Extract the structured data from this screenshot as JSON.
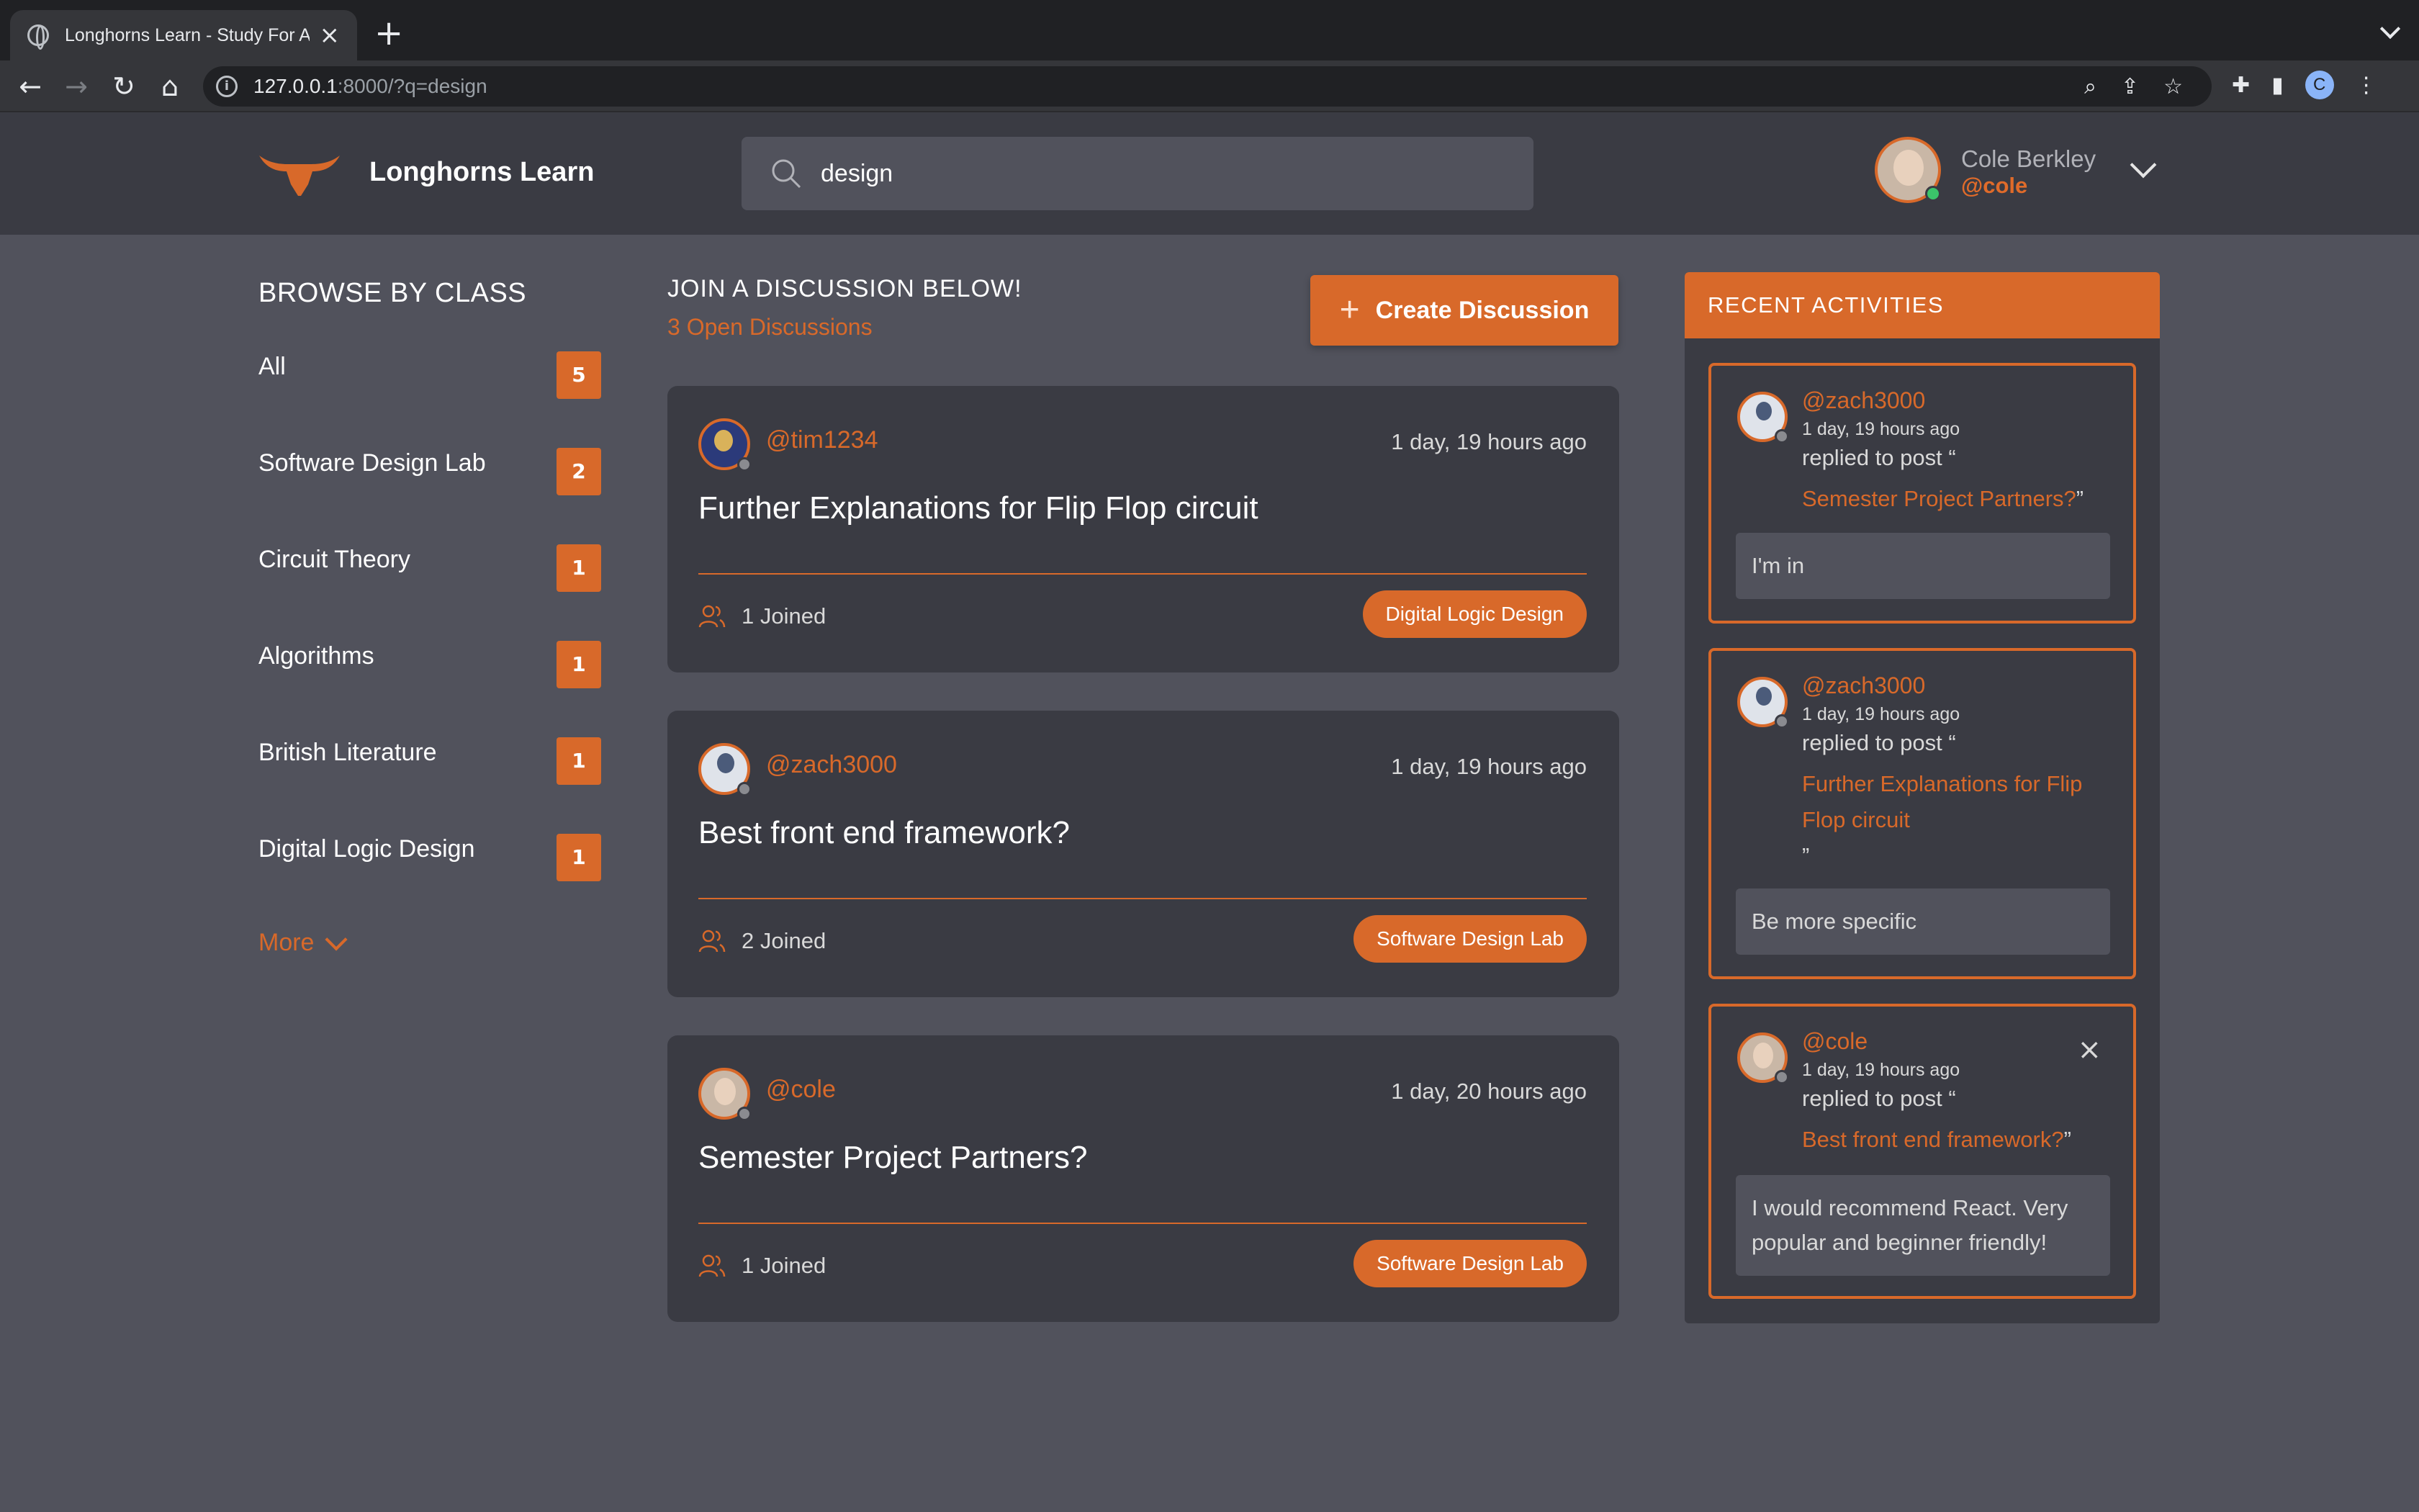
{
  "browser": {
    "tab_title": "Longhorns Learn - Study For A",
    "url_host": "127.0.0.1",
    "url_rest": ":8000/?q=design",
    "profile_initial": "C"
  },
  "header": {
    "brand": "Longhorns Learn",
    "search_value": "design",
    "user_name": "Cole Berkley",
    "user_handle": "@cole"
  },
  "sidebar": {
    "title": "BROWSE BY CLASS",
    "items": [
      {
        "label": "All",
        "count": "5"
      },
      {
        "label": "Software Design Lab",
        "count": "2"
      },
      {
        "label": "Circuit Theory",
        "count": "1"
      },
      {
        "label": "Algorithms",
        "count": "1"
      },
      {
        "label": "British Literature",
        "count": "1"
      },
      {
        "label": "Digital Logic Design",
        "count": "1"
      }
    ],
    "more_label": "More"
  },
  "feed": {
    "heading": "JOIN A DISCUSSION BELOW!",
    "subheading": "3 Open Discussions",
    "create_label": "Create Discussion",
    "posts": [
      {
        "user": "@tim1234",
        "time": "1 day, 19 hours ago",
        "title": "Further Explanations for Flip Flop circuit",
        "joined": "1 Joined",
        "tag": "Digital Logic Design"
      },
      {
        "user": "@zach3000",
        "time": "1 day, 19 hours ago",
        "title": "Best front end framework?",
        "joined": "2 Joined",
        "tag": "Software Design Lab"
      },
      {
        "user": "@cole",
        "time": "1 day, 20 hours ago",
        "title": "Semester Project Partners?",
        "joined": "1 Joined",
        "tag": "Software Design Lab"
      }
    ]
  },
  "activity": {
    "title": "RECENT ACTIVITIES",
    "items": [
      {
        "user": "@zach3000",
        "time": "1 day, 19 hours ago",
        "action": "replied to post “",
        "post": "Semester Project Partners?",
        "close_quote": "”",
        "reply": "I'm in"
      },
      {
        "user": "@zach3000",
        "time": "1 day, 19 hours ago",
        "action": "replied to post “",
        "post": "Further Explanations for Flip Flop circuit",
        "close_quote": "”",
        "reply": "Be more specific"
      },
      {
        "user": "@cole",
        "time": "1 day, 19 hours ago",
        "action": "replied to post “",
        "post": "Best front end framework?",
        "close_quote": "”",
        "reply": "I would recommend React. Very popular and beginner friendly!"
      }
    ]
  },
  "colors": {
    "accent": "#d8692a",
    "page_bg": "#51525c",
    "card_bg": "#3a3b43"
  }
}
